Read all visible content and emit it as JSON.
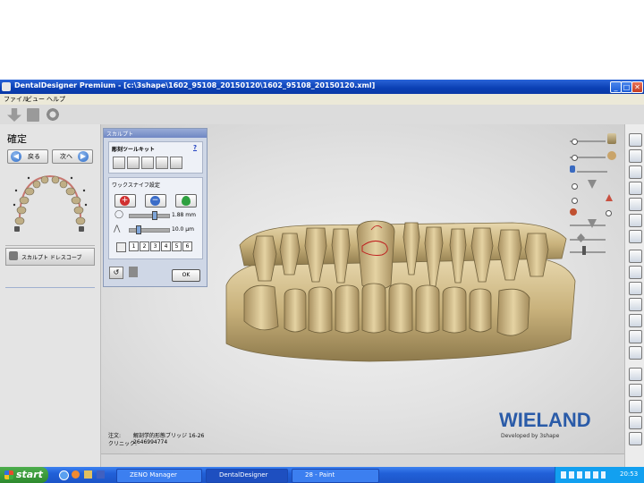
{
  "window": {
    "title": "DentalDesigner Premium - [c:\\3shape\\1602_95108_20150120\\1602_95108_20150120.xml]"
  },
  "menu": [
    "ファイル",
    "ビュー",
    "ヘルプ"
  ],
  "left_panel": {
    "heading": "確定",
    "back_label": "戻る",
    "next_label": "次へ",
    "sculpt_button_label": "スカルプト ドレスコーブ"
  },
  "sculpt_panel": {
    "title": "スカルプト",
    "toolkit_label": "彫刻ツールキット",
    "help_label": "?",
    "wax_label": "ワックスナイフ設定",
    "size_value": "1.88 mm",
    "depth_value": "10.0 μm",
    "numbers": [
      "1",
      "2",
      "3",
      "4",
      "5",
      "6"
    ],
    "ok_label": "OK"
  },
  "order": {
    "order_label": "注文:",
    "order_value": "解剖学的形態ブリッジ 16-26",
    "clinic_label": "クリニック:",
    "clinic_value": "2646994774"
  },
  "brand": {
    "name": "WIELAND",
    "tagline": "Developed by 3shape"
  },
  "taskbar": {
    "start_label": "start",
    "items": [
      "ZENO Manager",
      "DentalDesigner",
      "28 - Paint"
    ],
    "clock": "20:53"
  }
}
